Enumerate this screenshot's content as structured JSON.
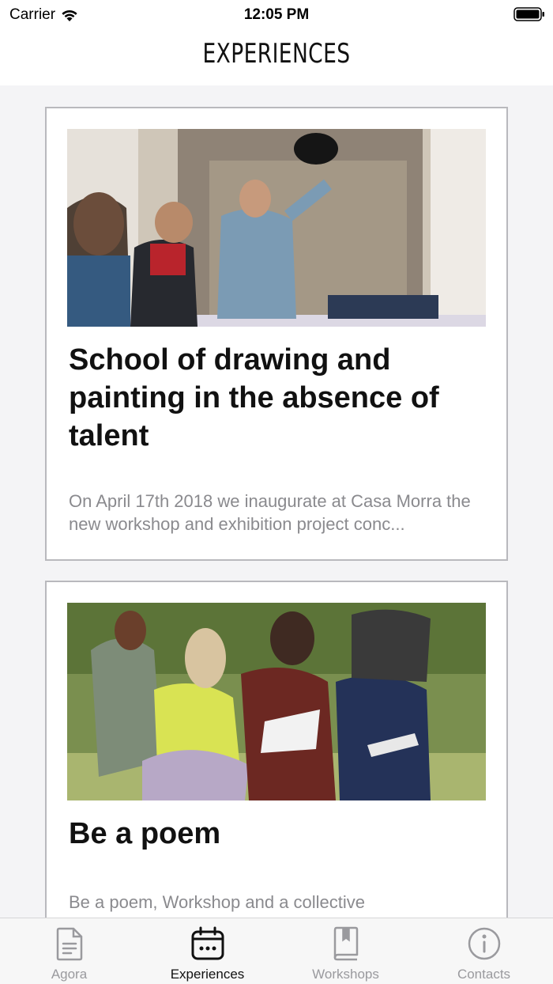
{
  "status_bar": {
    "carrier": "Carrier",
    "time": "12:05 PM"
  },
  "nav": {
    "title": "EXPERIENCES"
  },
  "cards": [
    {
      "title": "School of drawing and painting in the absence of talent",
      "description": "On April 17th 2018 we inaugurate at Casa Morra the new workshop and exhibition project conc..."
    },
    {
      "title": "Be a poem",
      "description": "Be a poem, Workshop and a collective"
    }
  ],
  "tabs": [
    {
      "label": "Agora",
      "icon": "document-icon"
    },
    {
      "label": "Experiences",
      "icon": "calendar-icon"
    },
    {
      "label": "Workshops",
      "icon": "book-icon"
    },
    {
      "label": "Contacts",
      "icon": "info-icon"
    }
  ],
  "active_tab": "Experiences",
  "colors": {
    "active": "#111111",
    "inactive": "#9a9a9e",
    "card_border": "#b9b9bd",
    "background": "#f4f4f6"
  }
}
